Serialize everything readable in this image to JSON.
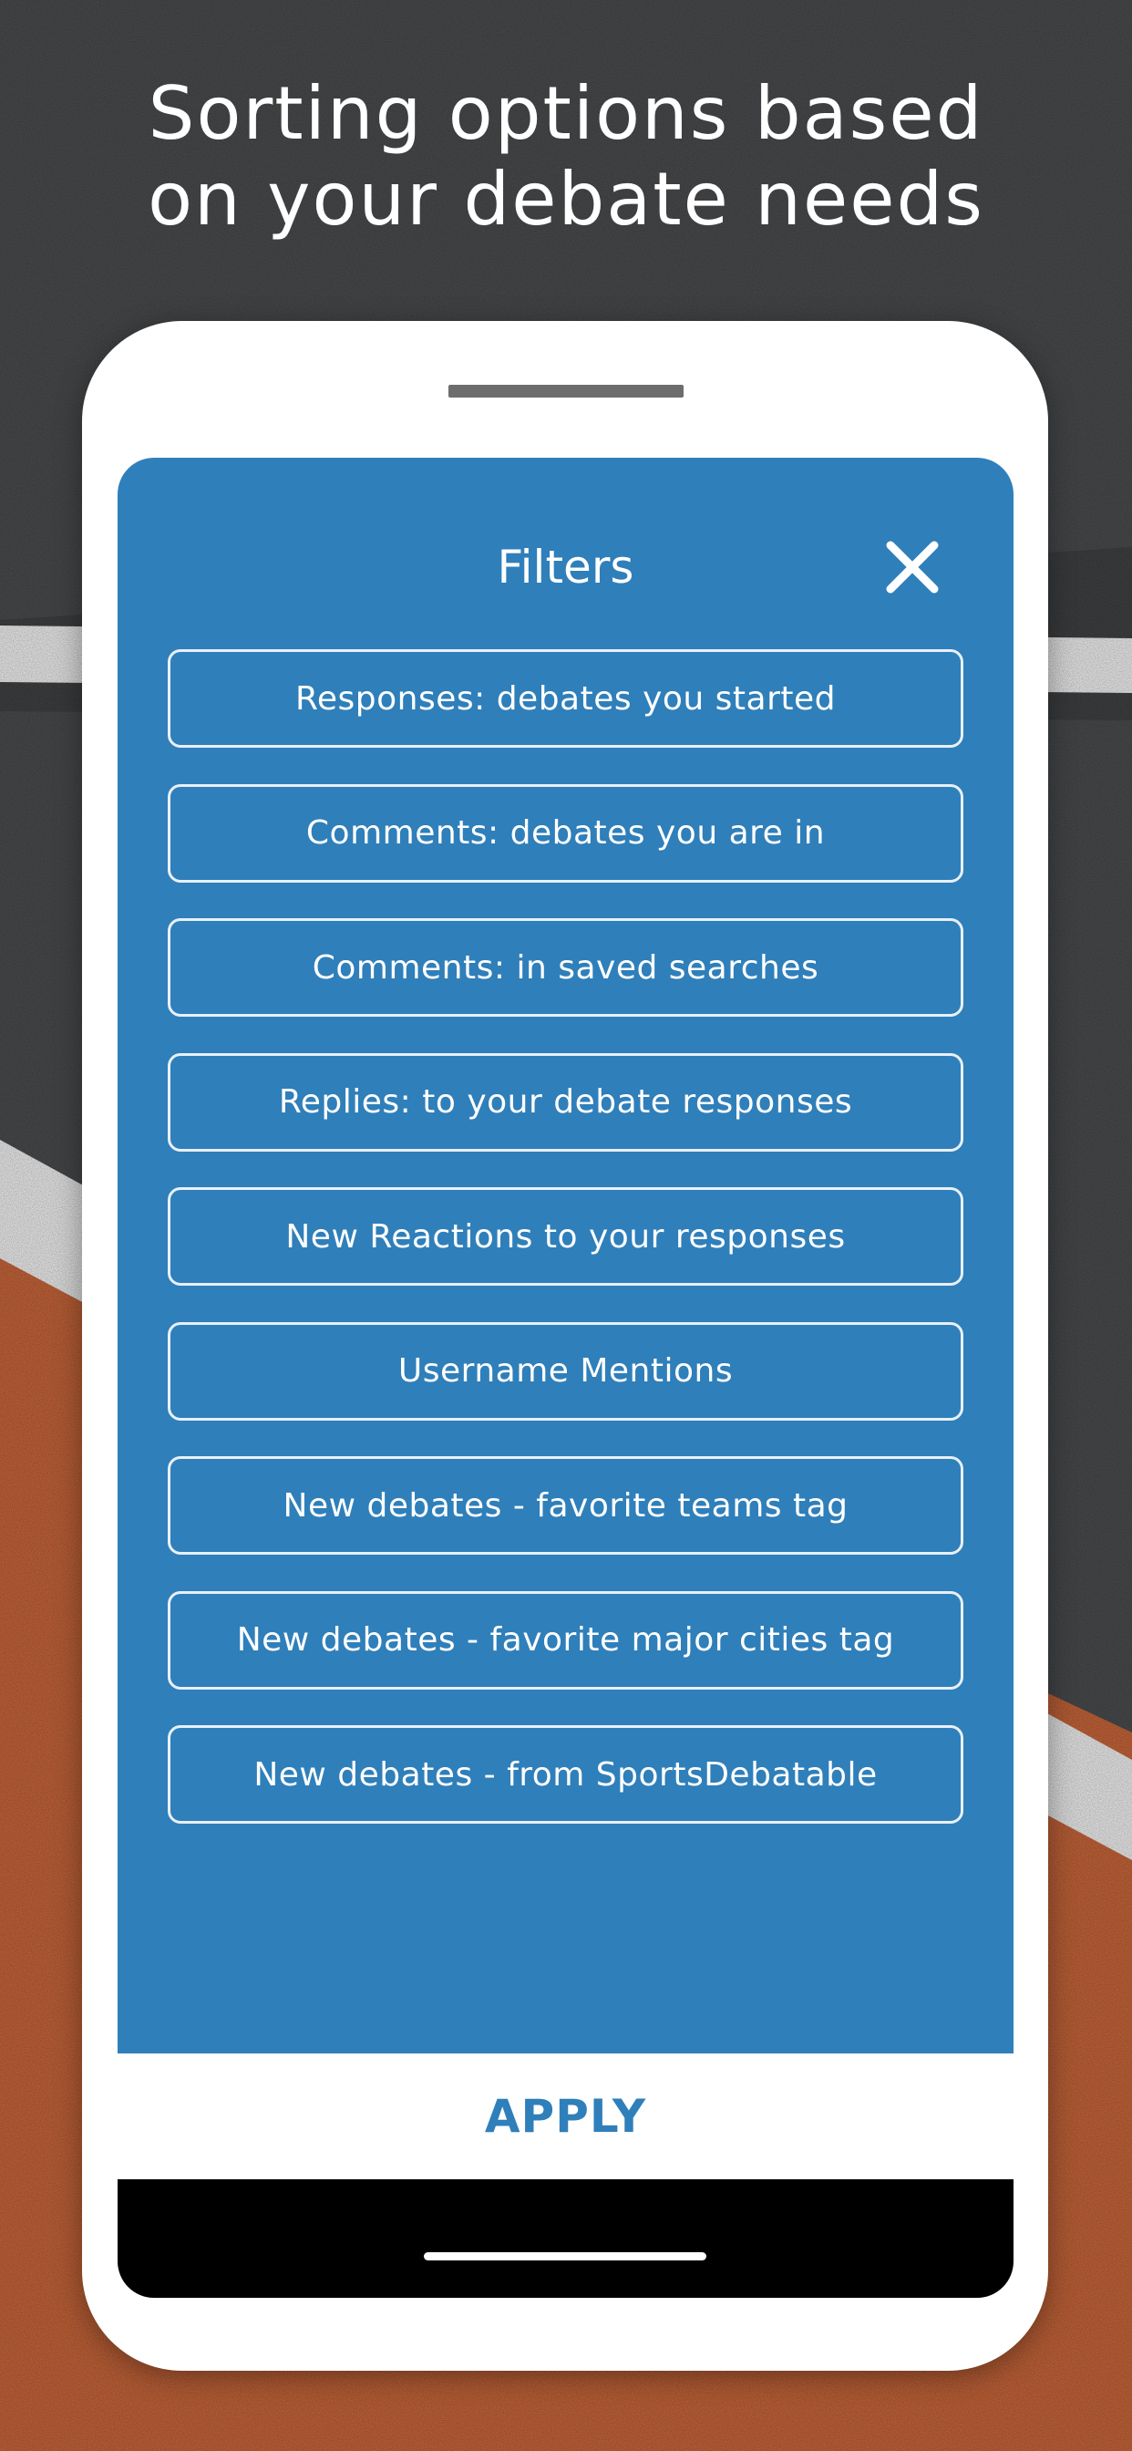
{
  "headline": {
    "line1": "Sorting options based",
    "line2": "on your debate needs"
  },
  "filters_panel": {
    "title": "Filters",
    "close_icon": "close-icon",
    "options": [
      {
        "label": "Responses: debates you started"
      },
      {
        "label": "Comments: debates you are in"
      },
      {
        "label": "Comments: in saved searches"
      },
      {
        "label": "Replies: to your debate responses"
      },
      {
        "label": "New Reactions to your responses"
      },
      {
        "label": "Username Mentions"
      },
      {
        "label": "New debates - favorite teams tag"
      },
      {
        "label": "New debates - favorite major cities tag"
      },
      {
        "label": "New debates - from SportsDebatable"
      }
    ]
  },
  "apply_label": "APPLY",
  "colors": {
    "accent": "#2f7fba",
    "asphalt": "#4b4d4f",
    "clay": "#c8663a",
    "court_line": "#ffffff"
  }
}
